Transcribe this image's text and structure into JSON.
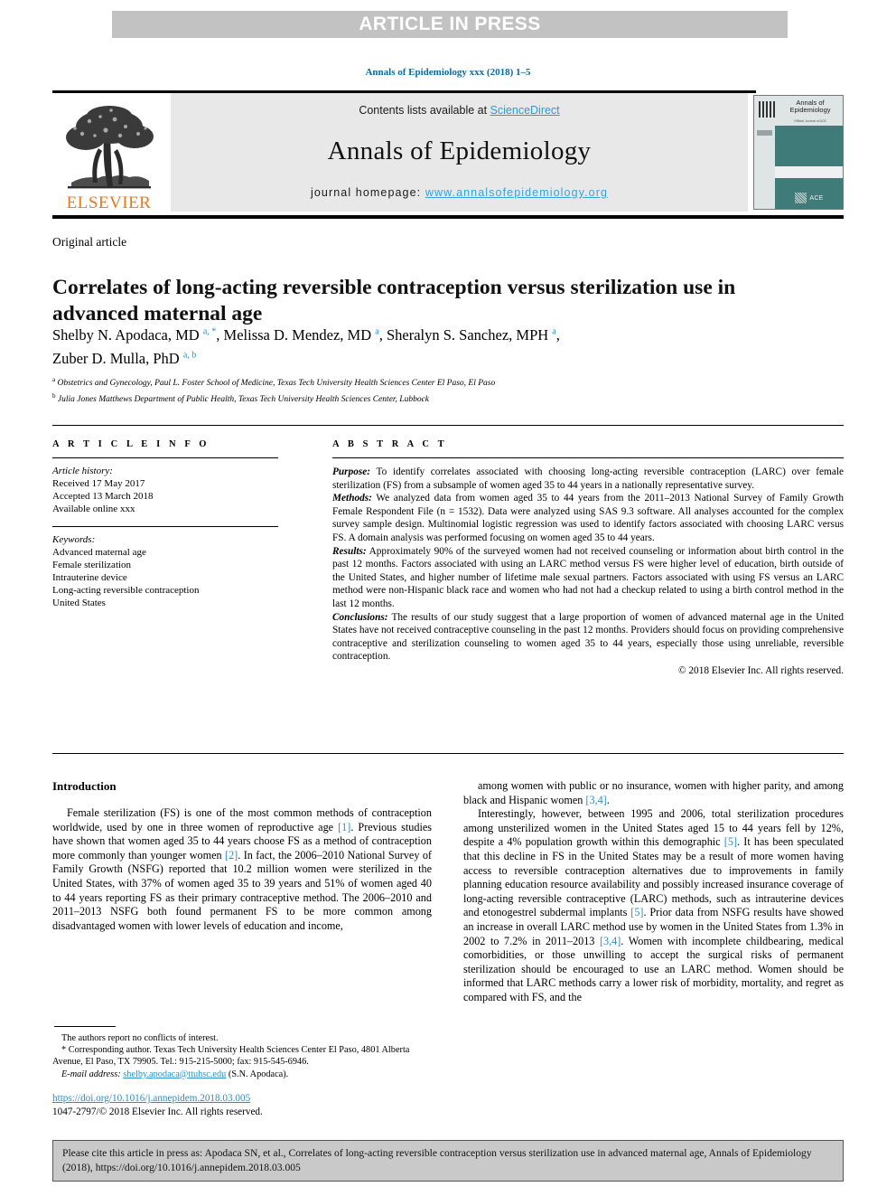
{
  "banner": {
    "text": "ARTICLE IN PRESS"
  },
  "running_head": {
    "text": "Annals of Epidemiology xxx (2018) 1–5"
  },
  "masthead": {
    "publisher": "ELSEVIER",
    "contents_prefix": "Contents lists available at ",
    "contents_link": "ScienceDirect",
    "journal_title": "Annals of Epidemiology",
    "homepage_prefix": "journal homepage: ",
    "homepage_url": "www.annalsofepidemiology.org",
    "cover": {
      "title": "Annals of Epidemiology",
      "subtitle": "Official Journal of ACE",
      "society": "ACE"
    }
  },
  "article": {
    "type": "Original article",
    "title": "Correlates of long-acting reversible contraception versus sterilization use in advanced maternal age",
    "authors_html": "Shelby N. Apodaca, MD <sup class=\"aff\">a</sup><sup class=\"star\">, *</sup>, Melissa D. Mendez, MD <sup class=\"aff\">a</sup>, Sheralyn S. Sanchez, MPH <sup class=\"aff\">a</sup>,<br>Zuber D. Mulla, PhD <sup class=\"aff\">a, b</sup>",
    "affiliation_a": "Obstetrics and Gynecology, Paul L. Foster School of Medicine, Texas Tech University Health Sciences Center El Paso, El Paso",
    "affiliation_b": "Julia Jones Matthews Department of Public Health, Texas Tech University Health Sciences Center, Lubbock"
  },
  "article_info": {
    "heading": "A R T I C L E  I N F O",
    "history_label": "Article history:",
    "history": [
      "Received 17 May 2017",
      "Accepted 13 March 2018",
      "Available online xxx"
    ],
    "keywords_label": "Keywords:",
    "keywords": [
      "Advanced maternal age",
      "Female sterilization",
      "Intrauterine device",
      "Long-acting reversible contraception",
      "United States"
    ]
  },
  "abstract": {
    "heading": "A B S T R A C T",
    "sections": [
      {
        "label": "Purpose:",
        "text": " To identify correlates associated with choosing long-acting reversible contraception (LARC) over female sterilization (FS) from a subsample of women aged 35 to 44 years in a nationally representative survey."
      },
      {
        "label": "Methods:",
        "text": " We analyzed data from women aged 35 to 44 years from the 2011–2013 National Survey of Family Growth Female Respondent File (n = 1532). Data were analyzed using SAS 9.3 software. All analyses accounted for the complex survey sample design. Multinomial logistic regression was used to identify factors associated with choosing LARC versus FS. A domain analysis was performed focusing on women aged 35 to 44 years."
      },
      {
        "label": "Results:",
        "text": " Approximately 90% of the surveyed women had not received counseling or information about birth control in the past 12 months. Factors associated with using an LARC method versus FS were higher level of education, birth outside of the United States, and higher number of lifetime male sexual partners. Factors associated with using FS versus an LARC method were non-Hispanic black race and women who had not had a checkup related to using a birth control method in the last 12 months."
      },
      {
        "label": "Conclusions:",
        "text": " The results of our study suggest that a large proportion of women of advanced maternal age in the United States have not received contraceptive counseling in the past 12 months. Providers should focus on providing comprehensive contraceptive and sterilization counseling to women aged 35 to 44 years, especially those using unreliable, reversible contraception."
      }
    ],
    "copyright": "© 2018 Elsevier Inc. All rights reserved."
  },
  "introduction": {
    "heading": "Introduction",
    "left_paragraph": "Female sterilization (FS) is one of the most common methods of contraception worldwide, used by one in three women of reproductive age <span class=\"ref\">[1]</span>. Previous studies have shown that women aged 35 to 44 years choose FS as a method of contraception more commonly than younger women <span class=\"ref\">[2]</span>. In fact, the 2006–2010 National Survey of Family Growth (NSFG) reported that 10.2 million women were sterilized in the United States, with 37% of women aged 35 to 39 years and 51% of women aged 40 to 44 years reporting FS as their primary contraceptive method. The 2006–2010 and 2011–2013 NSFG both found permanent FS to be more common among disadvantaged women with lower levels of education and income,",
    "right_paragraph_1": "among women with public or no insurance, women with higher parity, and among black and Hispanic women <span class=\"ref\">[3,4]</span>.",
    "right_paragraph_2": "Interestingly, however, between 1995 and 2006, total sterilization procedures among unsterilized women in the United States aged 15 to 44 years fell by 12%, despite a 4% population growth within this demographic <span class=\"ref\">[5]</span>. It has been speculated that this decline in FS in the United States may be a result of more women having access to reversible contraception alternatives due to improvements in family planning education resource availability and possibly increased insurance coverage of long-acting reversible contraceptive (LARC) methods, such as intrauterine devices and etonogestrel subdermal implants <span class=\"ref\">[5]</span>. Prior data from NSFG results have showed an increase in overall LARC method use by women in the United States from 1.3% in 2002 to 7.2% in 2011–2013 <span class=\"ref\">[3,4]</span>. Women with incomplete childbearing, medical comorbidities, or those unwilling to accept the surgical risks of permanent sterilization should be encouraged to use an LARC method. Women should be informed that LARC methods carry a lower risk of morbidity, mortality, and regret as compared with FS, and the"
  },
  "footnotes": {
    "conflict": "The authors report no conflicts of interest.",
    "corresponding": "* Corresponding author. Texas Tech University Health Sciences Center El Paso, 4801 Alberta Avenue, El Paso, TX 79905. Tel.: 915-215-5000; fax: 915-545-6946.",
    "email_label": "E-mail address:",
    "email": "shelby.apodaca@ttuhsc.edu",
    "email_suffix": " (S.N. Apodaca)."
  },
  "doi_block": {
    "doi_url": "https://doi.org/10.1016/j.annepidem.2018.03.005",
    "issn_line": "1047-2797/© 2018 Elsevier Inc. All rights reserved."
  },
  "cite_box": {
    "text": "Please cite this article in press as: Apodaca SN, et al., Correlates of long-acting reversible contraception versus sterilization use in advanced maternal age, Annals of Epidemiology (2018), https://doi.org/10.1016/j.annepidem.2018.03.005"
  },
  "colors": {
    "banner_bg": "#c2c2c2",
    "link_blue": "#2a8fc4",
    "sciencedirect_blue": "#2f9bd1",
    "elsevier_orange": "#e87722",
    "cover_teal": "#3f7b79",
    "cite_box_bg": "#c9c9c9",
    "running_head_blue": "#0a6a9e"
  }
}
